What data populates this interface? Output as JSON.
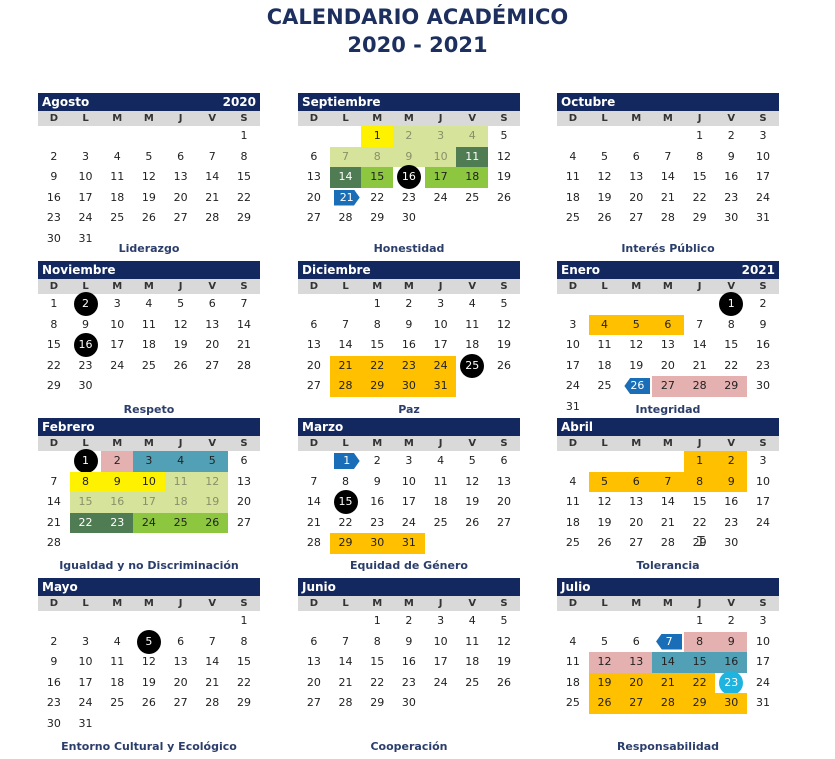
{
  "title_line1": "CALENDARIO ACADÉMICO",
  "title_line2": "2020 - 2021",
  "dow": [
    "D",
    "L",
    "M",
    "M",
    "J",
    "V",
    "S"
  ],
  "colors": {
    "header": "#13285f",
    "yellow": "#fff200",
    "light_green": "#d6e39a",
    "dark_green": "#4f7c52",
    "green": "#8dc63f",
    "gold": "#ffc000",
    "pink": "#e4b0b0",
    "teal": "#52a0b5",
    "blue_arrow": "#1a6eb8",
    "circle": "#000000",
    "cyan_circle": "#1fb3e0"
  },
  "months": [
    {
      "name": "Agosto",
      "year": "2020",
      "value": "Liderazgo",
      "weeks": [
        [
          null,
          null,
          null,
          null,
          null,
          null,
          1
        ],
        [
          2,
          3,
          4,
          5,
          6,
          7,
          8
        ],
        [
          9,
          10,
          11,
          12,
          13,
          14,
          15
        ],
        [
          16,
          17,
          18,
          19,
          20,
          21,
          22
        ],
        [
          23,
          24,
          25,
          26,
          27,
          28,
          29
        ],
        [
          30,
          31,
          null,
          null,
          null,
          null,
          null
        ]
      ],
      "marks": {}
    },
    {
      "name": "Septiembre",
      "year": "",
      "value": "Honestidad",
      "weeks": [
        [
          null,
          null,
          1,
          2,
          3,
          4,
          5
        ],
        [
          6,
          7,
          8,
          9,
          10,
          11,
          12
        ],
        [
          13,
          14,
          15,
          16,
          17,
          18,
          19
        ],
        [
          20,
          21,
          22,
          23,
          24,
          25,
          26
        ],
        [
          27,
          28,
          29,
          30,
          null,
          null,
          null
        ]
      ],
      "marks": {
        "1": "yellow",
        "2": "lg",
        "3": "lg",
        "4": "lg",
        "7": "lg",
        "8": "lg",
        "9": "lg",
        "10": "lg",
        "11": "dg",
        "14": "dg",
        "15": "g",
        "16": "circle",
        "17": "g",
        "18": "g",
        "21": "arrow"
      }
    },
    {
      "name": "Octubre",
      "year": "",
      "value": "Interés Público",
      "weeks": [
        [
          null,
          null,
          null,
          null,
          1,
          2,
          3
        ],
        [
          4,
          5,
          6,
          7,
          8,
          9,
          10
        ],
        [
          11,
          12,
          13,
          14,
          15,
          16,
          17
        ],
        [
          18,
          19,
          20,
          21,
          22,
          23,
          24
        ],
        [
          25,
          26,
          27,
          28,
          29,
          30,
          31
        ]
      ],
      "marks": {}
    },
    {
      "name": "Noviembre",
      "year": "",
      "value": "Respeto",
      "weeks": [
        [
          1,
          2,
          3,
          4,
          5,
          6,
          7
        ],
        [
          8,
          9,
          10,
          11,
          12,
          13,
          14
        ],
        [
          15,
          16,
          17,
          18,
          19,
          20,
          21
        ],
        [
          22,
          23,
          24,
          25,
          26,
          27,
          28
        ],
        [
          29,
          30,
          null,
          null,
          null,
          null,
          null
        ]
      ],
      "marks": {
        "2": "circle",
        "16": "circle"
      }
    },
    {
      "name": "Diciembre",
      "year": "",
      "value": "Paz",
      "weeks": [
        [
          null,
          null,
          1,
          2,
          3,
          4,
          5
        ],
        [
          6,
          7,
          8,
          9,
          10,
          11,
          12
        ],
        [
          13,
          14,
          15,
          16,
          17,
          18,
          19
        ],
        [
          20,
          21,
          22,
          23,
          24,
          25,
          26
        ],
        [
          27,
          28,
          29,
          30,
          31,
          null,
          null
        ]
      ],
      "marks": {
        "21": "gold",
        "22": "gold",
        "23": "gold",
        "24": "gold",
        "25": "circle",
        "28": "gold",
        "29": "gold",
        "30": "gold",
        "31": "gold"
      }
    },
    {
      "name": "Enero",
      "year": "2021",
      "value": "Integridad",
      "weeks": [
        [
          null,
          null,
          null,
          null,
          null,
          1,
          2
        ],
        [
          3,
          4,
          5,
          6,
          7,
          8,
          9
        ],
        [
          10,
          11,
          12,
          13,
          14,
          15,
          16
        ],
        [
          17,
          18,
          19,
          20,
          21,
          22,
          23
        ],
        [
          24,
          25,
          26,
          27,
          28,
          29,
          30
        ],
        [
          31,
          null,
          null,
          null,
          null,
          null,
          null
        ]
      ],
      "marks": {
        "1": "circle",
        "4": "gold",
        "5": "gold",
        "6": "gold",
        "26": "arrowleft",
        "27": "pink",
        "28": "pink",
        "29": "pink"
      }
    },
    {
      "name": "Febrero",
      "year": "",
      "value": "Igualdad y no Discriminación",
      "weeks": [
        [
          null,
          1,
          2,
          3,
          4,
          5,
          6
        ],
        [
          7,
          8,
          9,
          10,
          11,
          12,
          13
        ],
        [
          14,
          15,
          16,
          17,
          18,
          19,
          20
        ],
        [
          21,
          22,
          23,
          24,
          25,
          26,
          27
        ],
        [
          28,
          null,
          null,
          null,
          null,
          null,
          null
        ]
      ],
      "marks": {
        "1": "circle",
        "2": "pink",
        "3": "teal",
        "4": "teal",
        "5": "teal",
        "8": "yellow",
        "9": "yellow",
        "10": "yellow",
        "11": "lg",
        "12": "lg",
        "15": "lg",
        "16": "lg",
        "17": "lg",
        "18": "lg",
        "19": "lg",
        "22": "dg",
        "23": "dg",
        "24": "g",
        "25": "g",
        "26": "g"
      }
    },
    {
      "name": "Marzo",
      "year": "",
      "value": "Equidad de Género",
      "weeks": [
        [
          null,
          1,
          2,
          3,
          4,
          5,
          6
        ],
        [
          7,
          8,
          9,
          10,
          11,
          12,
          13
        ],
        [
          14,
          15,
          16,
          17,
          18,
          19,
          20
        ],
        [
          21,
          22,
          23,
          24,
          25,
          26,
          27
        ],
        [
          28,
          29,
          30,
          31,
          null,
          null,
          null
        ]
      ],
      "marks": {
        "1": "arrow",
        "15": "circle",
        "29": "gold",
        "30": "gold",
        "31": "gold"
      }
    },
    {
      "name": "Abril",
      "year": "",
      "value": "Tolerancia",
      "weeks": [
        [
          null,
          null,
          null,
          null,
          1,
          2,
          3
        ],
        [
          4,
          5,
          6,
          7,
          8,
          9,
          10
        ],
        [
          11,
          12,
          13,
          14,
          15,
          16,
          17
        ],
        [
          18,
          19,
          20,
          21,
          22,
          23,
          24
        ],
        [
          25,
          26,
          27,
          28,
          29,
          30,
          null
        ]
      ],
      "marks": {
        "1": "gold",
        "2": "gold",
        "5": "gold",
        "6": "gold",
        "7": "gold",
        "8": "gold",
        "9": "gold"
      }
    },
    {
      "name": "Mayo",
      "year": "",
      "value": "Entorno Cultural y Ecológico",
      "weeks": [
        [
          null,
          null,
          null,
          null,
          null,
          null,
          1
        ],
        [
          2,
          3,
          4,
          5,
          6,
          7,
          8
        ],
        [
          9,
          10,
          11,
          12,
          13,
          14,
          15
        ],
        [
          16,
          17,
          18,
          19,
          20,
          21,
          22
        ],
        [
          23,
          24,
          25,
          26,
          27,
          28,
          29
        ],
        [
          30,
          31,
          null,
          null,
          null,
          null,
          null
        ]
      ],
      "marks": {
        "5": "circle"
      }
    },
    {
      "name": "Junio",
      "year": "",
      "value": "Cooperación",
      "weeks": [
        [
          null,
          null,
          1,
          2,
          3,
          4,
          5
        ],
        [
          6,
          7,
          8,
          9,
          10,
          11,
          12
        ],
        [
          13,
          14,
          15,
          16,
          17,
          18,
          19
        ],
        [
          20,
          21,
          22,
          23,
          24,
          25,
          26
        ],
        [
          27,
          28,
          29,
          30,
          null,
          null,
          null
        ]
      ],
      "marks": {}
    },
    {
      "name": "Julio",
      "year": "",
      "value": "Responsabilidad",
      "weeks": [
        [
          null,
          null,
          null,
          null,
          1,
          2,
          3
        ],
        [
          4,
          5,
          6,
          7,
          8,
          9,
          10
        ],
        [
          11,
          12,
          13,
          14,
          15,
          16,
          17
        ],
        [
          18,
          19,
          20,
          21,
          22,
          23,
          24
        ],
        [
          25,
          26,
          27,
          28,
          29,
          30,
          31
        ]
      ],
      "marks": {
        "7": "arrowleft",
        "8": "pink",
        "9": "pink",
        "12": "pink",
        "13": "pink",
        "14": "teal",
        "15": "teal",
        "16": "teal",
        "19": "gold",
        "20": "gold",
        "21": "gold",
        "22": "gold",
        "23": "cyancircle",
        "26": "gold",
        "27": "gold",
        "28": "gold",
        "29": "gold",
        "30": "gold"
      }
    }
  ]
}
